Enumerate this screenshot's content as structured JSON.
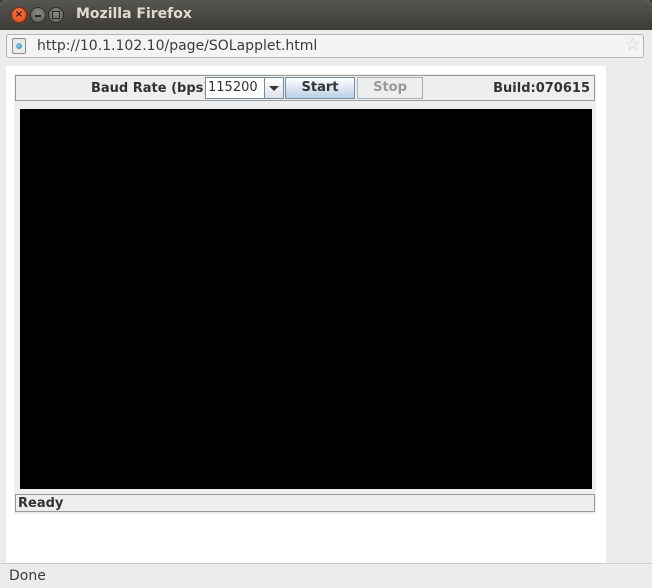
{
  "window": {
    "title": "Mozilla Firefox",
    "close_glyph": "×"
  },
  "urlbar": {
    "url": "http://10.1.102.10/page/SOLapplet.html",
    "bookmark_glyph": "☆"
  },
  "applet": {
    "baud_label": "Baud Rate (bps)",
    "baud_value": "115200",
    "start_label": "Start",
    "stop_label": "Stop",
    "build_label": "Build:070615",
    "status": "Ready"
  },
  "browser_status": {
    "text": "Done"
  },
  "icons": {
    "close": "close-icon",
    "minimize": "minimize-icon",
    "maximize": "maximize-icon",
    "site": "site-identity-icon",
    "bookmark": "star-icon",
    "dropdown": "chevron-down-icon"
  },
  "colors": {
    "titlebar": "#3c3b37",
    "close_button": "#e65a2a",
    "terminal_bg": "#000000",
    "start_button": "#b8cfe5"
  }
}
